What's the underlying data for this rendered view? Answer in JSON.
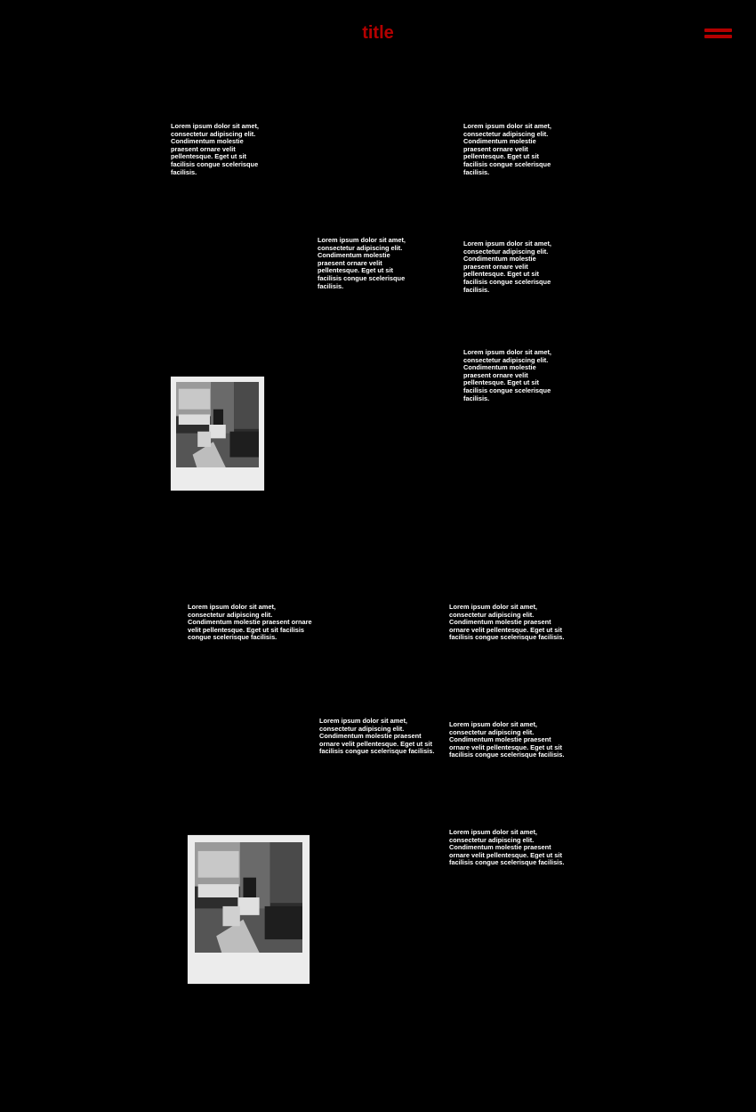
{
  "header": {
    "title": "title",
    "menu_icon": "hamburger-menu-icon",
    "accent_color": "#b30000"
  },
  "section1": {
    "col_right_top": "Lorem ipsum dolor sit amet, consectetur adipiscing elit. Condimentum molestie praesent ornare velit pellentesque. Eget ut sit facilisis congue scelerisque facilisis.",
    "col_left_top": "Lorem ipsum dolor sit amet, consectetur adipiscing elit. Condimentum molestie praesent ornare velit pellentesque. Eget ut sit facilisis congue scelerisque facilisis.",
    "col_middle": "Lorem ipsum dolor sit amet, consectetur adipiscing elit. Condimentum molestie praesent ornare velit pellentesque. Eget ut sit facilisis congue scelerisque facilisis.",
    "col_right_middle": "Lorem ipsum dolor sit amet, consectetur adipiscing elit. Condimentum molestie praesent ornare velit pellentesque. Eget ut sit facilisis congue scelerisque facilisis.",
    "col_right_bottom": "Lorem ipsum dolor sit amet, consectetur adipiscing elit. Condimentum molestie praesent ornare velit pellentesque. Eget ut sit facilisis congue scelerisque facilisis."
  },
  "section2": {
    "col_left_top": "Lorem ipsum dolor sit amet, consectetur adipiscing elit. Condimentum molestie praesent ornare velit pellentesque. Eget ut sit facilisis congue scelerisque facilisis.",
    "col_right_top": "Lorem ipsum dolor sit amet, consectetur adipiscing elit. Condimentum molestie praesent ornare velit pellentesque. Eget ut sit facilisis congue scelerisque facilisis.",
    "col_middle": "Lorem ipsum dolor sit amet, consectetur adipiscing elit. Condimentum molestie praesent ornare velit pellentesque. Eget ut sit facilisis congue scelerisque facilisis.",
    "col_right_middle": "Lorem ipsum dolor sit amet, consectetur adipiscing elit. Condimentum molestie praesent ornare velit pellentesque. Eget ut sit facilisis congue scelerisque facilisis.",
    "col_right_bottom": "Lorem ipsum dolor sit amet, consectetur adipiscing elit. Condimentum molestie praesent ornare velit pellentesque. Eget ut sit facilisis congue scelerisque facilisis."
  },
  "colors": {
    "background": "#000000",
    "text": "#ffffff",
    "polaroid_frame": "#ececec"
  }
}
